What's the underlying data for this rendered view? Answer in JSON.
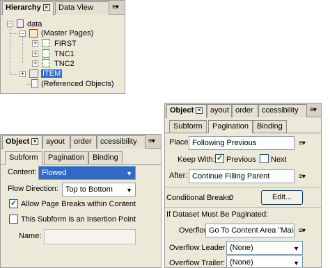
{
  "hierarchy_panel": {
    "tabs": [
      "Hierarchy",
      "Data View"
    ],
    "tree": {
      "root": "data",
      "master_pages": "(Master Pages)",
      "pages": [
        "FIRST",
        "TNC1",
        "TNC2"
      ],
      "item": "ITEM",
      "referenced": "(Referenced Objects)"
    }
  },
  "object_left": {
    "tabs": [
      "Object",
      "ayout",
      "order",
      "ccessibility"
    ],
    "subtabs": [
      "Subform",
      "Pagination",
      "Binding"
    ],
    "content_label": "Content:",
    "content_value": "Flowed",
    "flow_label": "Flow Direction:",
    "flow_value": "Top to Bottom",
    "allow_breaks": "Allow Page Breaks within Content",
    "insertion_point": "This Subform is an Insertion Point",
    "name_label": "Name:"
  },
  "object_right": {
    "tabs": [
      "Object",
      "ayout",
      "order",
      "ccessibility"
    ],
    "subtabs": [
      "Subform",
      "Pagination",
      "Binding"
    ],
    "place_label": "Place:",
    "place_value": "Following Previous",
    "keep_with_label": "Keep With:",
    "previous_label": "Previous",
    "next_label": "Next",
    "after_label": "After:",
    "after_value": "Continue Filling Parent",
    "conditional_label": "Conditional Breaks:",
    "conditional_count": "0",
    "edit_button": "Edit...",
    "paginated_heading": "If Dataset Must Be Paginated:",
    "overflow_label": "Overflow:",
    "overflow_value": "Go To Content Area \"Main\"",
    "leader_label": "Overflow Leader:",
    "leader_value": "(None)",
    "trailer_label": "Overflow Trailer:",
    "trailer_value": "(None)"
  }
}
